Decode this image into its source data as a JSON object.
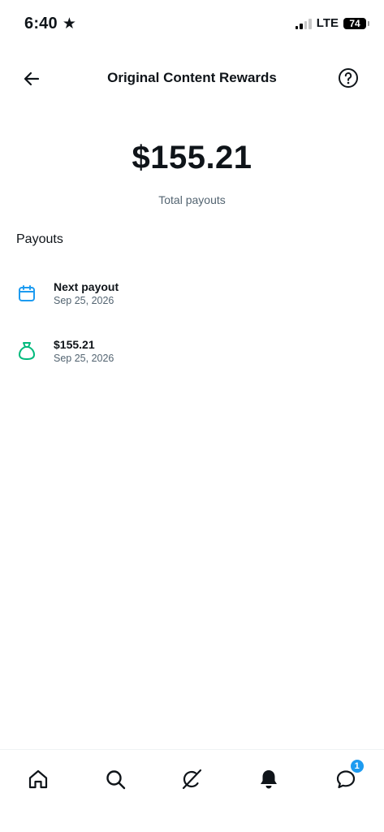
{
  "status_bar": {
    "time": "6:40",
    "network": "LTE",
    "battery": "74"
  },
  "header": {
    "title": "Original Content Rewards"
  },
  "summary": {
    "amount": "$155.21",
    "label": "Total payouts"
  },
  "payouts": {
    "title": "Payouts",
    "items": [
      {
        "primary": "Next payout",
        "secondary": "Sep 25, 2026",
        "icon": "calendar-icon",
        "color": "#1d9bf0"
      },
      {
        "primary": "$155.21",
        "secondary": "Sep 25, 2026",
        "icon": "money-bag-icon",
        "color": "#00ba7c"
      }
    ]
  },
  "nav": {
    "items": [
      "home-icon",
      "search-icon",
      "grok-icon",
      "notifications-icon",
      "messages-icon"
    ],
    "messages_badge": "1"
  },
  "colors": {
    "accent": "#1d9bf0",
    "success": "#00ba7c",
    "text_secondary": "#536471"
  }
}
